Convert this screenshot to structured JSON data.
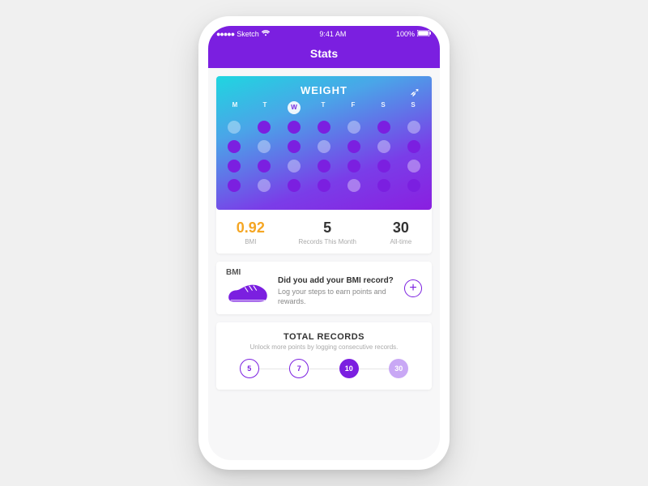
{
  "status": {
    "carrier": "Sketch",
    "time": "9:41 AM",
    "battery": "100%"
  },
  "nav": {
    "title": "Stats"
  },
  "weight": {
    "title": "WEIGHT",
    "days": [
      "M",
      "T",
      "W",
      "T",
      "F",
      "S",
      "S"
    ],
    "active_day_index": 2,
    "grid": [
      [
        0,
        1,
        1,
        1,
        0,
        1,
        0
      ],
      [
        1,
        0,
        1,
        0,
        1,
        0,
        1
      ],
      [
        1,
        1,
        0,
        1,
        1,
        1,
        0
      ],
      [
        1,
        0,
        1,
        1,
        0,
        1,
        1
      ]
    ]
  },
  "stats": [
    {
      "value": "0.92",
      "label": "BMI",
      "accent": true
    },
    {
      "value": "5",
      "label": "Records This Month",
      "accent": false
    },
    {
      "value": "30",
      "label": "All-time",
      "accent": false
    }
  ],
  "bmi_card": {
    "tag": "BMI",
    "title": "Did you add your BMI record?",
    "subtitle": "Log your steps to earn points and rewards."
  },
  "records": {
    "title": "TOTAL RECORDS",
    "subtitle": "Unlock more points by logging consecutive records.",
    "milestones": [
      {
        "value": "5",
        "state": "outline"
      },
      {
        "value": "7",
        "state": "outline"
      },
      {
        "value": "10",
        "state": "filled"
      },
      {
        "value": "30",
        "state": "faded"
      }
    ]
  }
}
